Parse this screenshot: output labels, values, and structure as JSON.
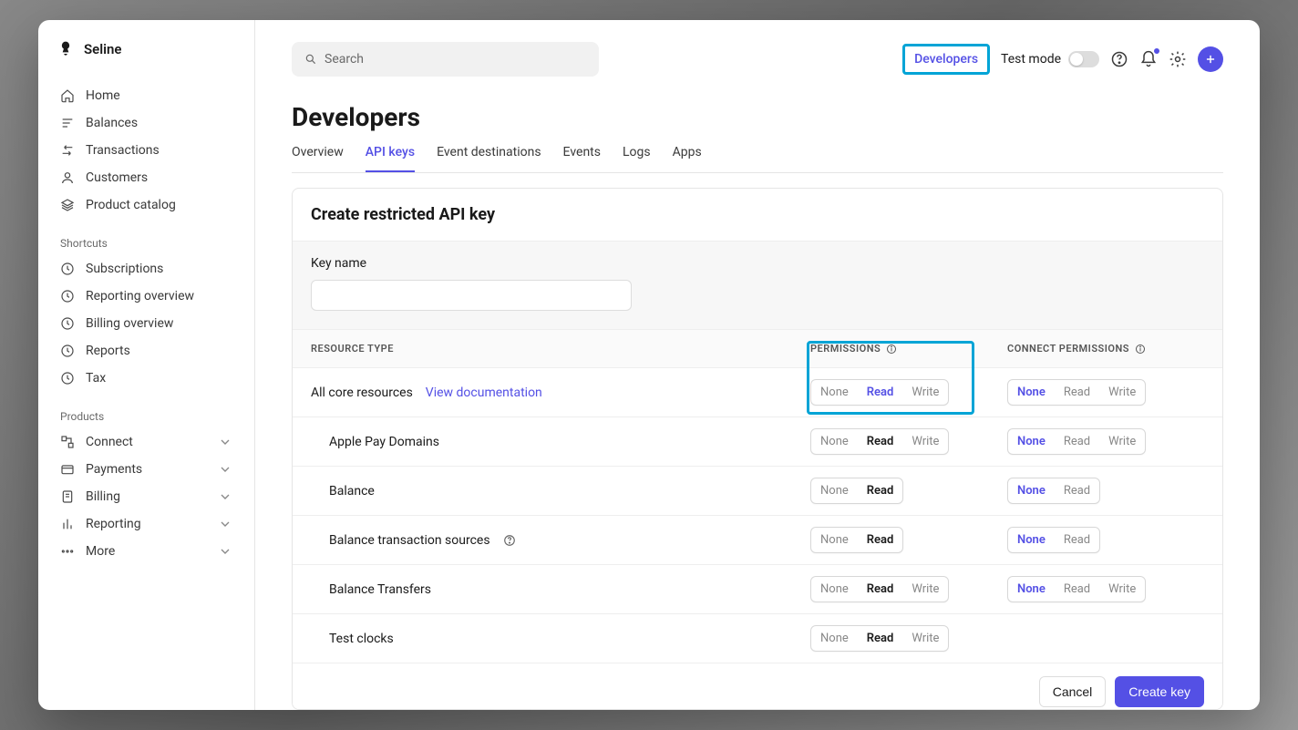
{
  "brand": {
    "name": "Seline"
  },
  "search": {
    "placeholder": "Search"
  },
  "header": {
    "developers_link": "Developers",
    "test_mode_label": "Test mode"
  },
  "sidebar": {
    "main": [
      {
        "icon": "home",
        "label": "Home"
      },
      {
        "icon": "balances",
        "label": "Balances"
      },
      {
        "icon": "transactions",
        "label": "Transactions"
      },
      {
        "icon": "customers",
        "label": "Customers"
      },
      {
        "icon": "catalog",
        "label": "Product catalog"
      }
    ],
    "shortcuts_label": "Shortcuts",
    "shortcuts": [
      {
        "label": "Subscriptions"
      },
      {
        "label": "Reporting overview"
      },
      {
        "label": "Billing overview"
      },
      {
        "label": "Reports"
      },
      {
        "label": "Tax"
      }
    ],
    "products_label": "Products",
    "products": [
      {
        "label": "Connect"
      },
      {
        "label": "Payments"
      },
      {
        "label": "Billing"
      },
      {
        "label": "Reporting"
      },
      {
        "label": "More"
      }
    ]
  },
  "page": {
    "title": "Developers",
    "tabs": [
      "Overview",
      "API keys",
      "Event destinations",
      "Events",
      "Logs",
      "Apps"
    ],
    "active_tab": "API keys"
  },
  "panel": {
    "title": "Create restricted API key",
    "key_name_label": "Key name",
    "key_name_value": "",
    "col_resource": "RESOURCE TYPE",
    "col_perm": "PERMISSIONS",
    "col_connect": "CONNECT PERMISSIONS",
    "doc_link": "View documentation",
    "rows": [
      {
        "name": "All core resources",
        "doc": true,
        "perm": [
          "None",
          "Read",
          "Write"
        ],
        "perm_sel": 1,
        "perm_blue": true,
        "conn": [
          "None",
          "Read",
          "Write"
        ],
        "conn_sel": 0,
        "conn_blue": true,
        "highlight": true
      },
      {
        "name": "Apple Pay Domains",
        "indent": true,
        "perm": [
          "None",
          "Read",
          "Write"
        ],
        "perm_sel": 1,
        "conn": [
          "None",
          "Read",
          "Write"
        ],
        "conn_sel": 0,
        "conn_blue": true
      },
      {
        "name": "Balance",
        "indent": true,
        "perm": [
          "None",
          "Read"
        ],
        "perm_sel": 1,
        "conn": [
          "None",
          "Read"
        ],
        "conn_sel": 0,
        "conn_blue": true
      },
      {
        "name": "Balance transaction sources",
        "indent": true,
        "q": true,
        "perm": [
          "None",
          "Read"
        ],
        "perm_sel": 1,
        "conn": [
          "None",
          "Read"
        ],
        "conn_sel": 0,
        "conn_blue": true
      },
      {
        "name": "Balance Transfers",
        "indent": true,
        "perm": [
          "None",
          "Read",
          "Write"
        ],
        "perm_sel": 1,
        "conn": [
          "None",
          "Read",
          "Write"
        ],
        "conn_sel": 0,
        "conn_blue": true
      },
      {
        "name": "Test clocks",
        "indent": true,
        "perm": [
          "None",
          "Read",
          "Write"
        ],
        "perm_sel": 1
      }
    ],
    "cancel": "Cancel",
    "create": "Create key"
  }
}
